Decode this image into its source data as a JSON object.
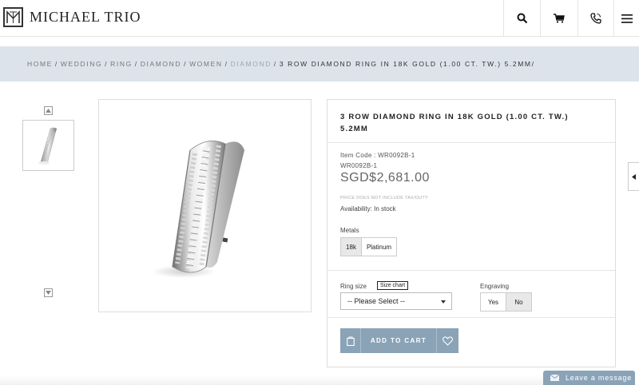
{
  "brand": {
    "name": "MICHAEL TRIO",
    "logo_icon": "mt-monogram-icon"
  },
  "header": {
    "icons": [
      "search-icon",
      "cart-icon",
      "phone-icon",
      "menu-icon"
    ]
  },
  "breadcrumb": {
    "items": [
      "HOME",
      "WEDDING",
      "RING",
      "DIAMOND",
      "WOMEN",
      "DIAMOND"
    ],
    "current": "3 ROW DIAMOND RING IN 18K GOLD (1.00 CT. TW.) 5.2MM/",
    "separator": "/"
  },
  "gallery": {
    "up_icon": "chevron-up-icon",
    "down_icon": "chevron-down-icon"
  },
  "product": {
    "title": "3 ROW DIAMOND RING IN 18K GOLD (1.00 CT. TW.) 5.2MM",
    "item_code": "Item Code : WR0092B-1",
    "sku": "WR0092B-1",
    "currency": "SGD$",
    "price": "2,681.00",
    "price_note": "PRICE DOES NOT INCLUDE TAX/DUTY",
    "availability": "Availability: In stock",
    "metals_label": "Metals",
    "metals": [
      "18k",
      "Platinum"
    ],
    "selected_metal": "18k",
    "ring_size_label": "Ring size",
    "size_chart_label": "Size chart",
    "size_select_value": "-- Please Select --",
    "engraving_label": "Engraving",
    "engraving_options": [
      "Yes",
      "No"
    ],
    "add_to_cart_label": "ADD TO CART"
  },
  "chat": {
    "label": "Leave a message"
  },
  "colors": {
    "accent": "#8aa3b7",
    "breadcrumb_bg": "#dde3ea"
  }
}
